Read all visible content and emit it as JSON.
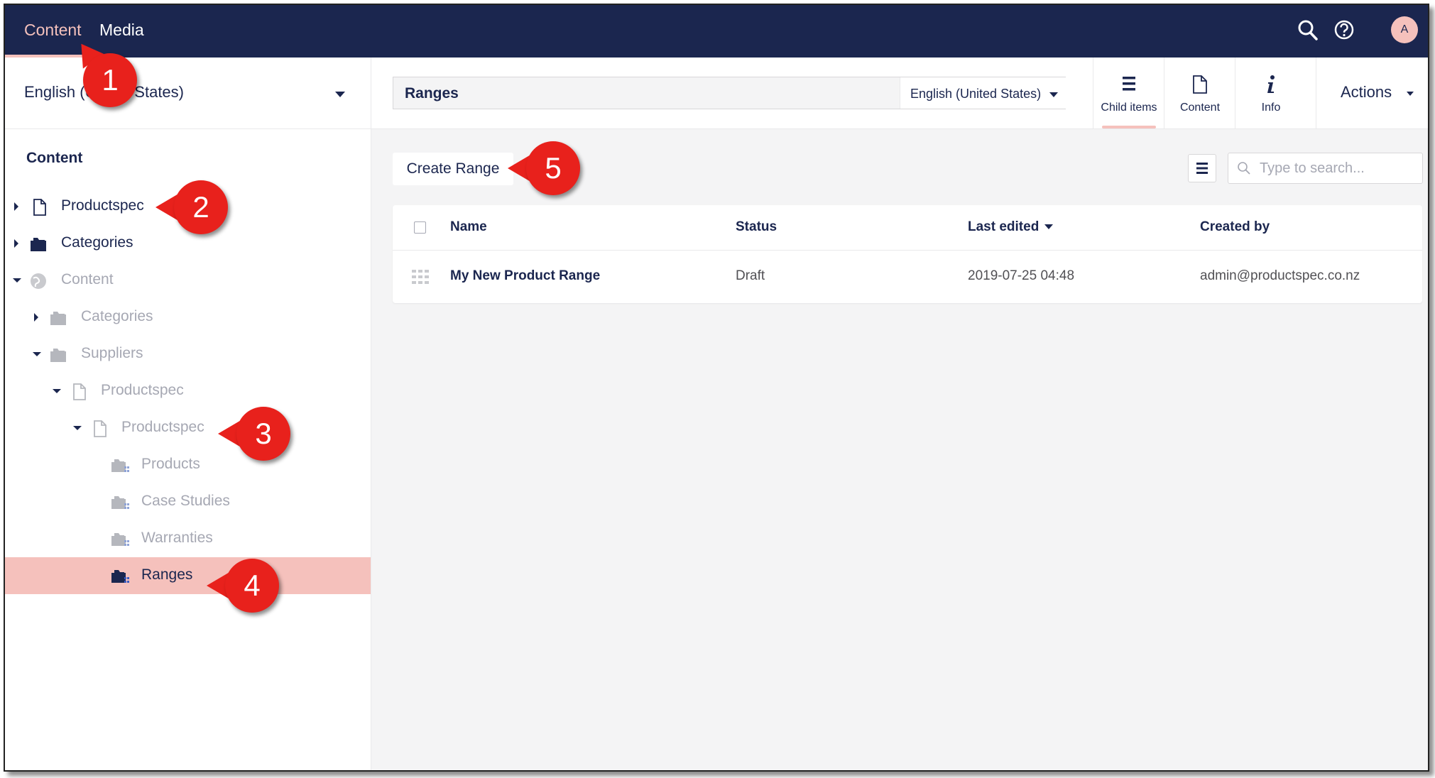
{
  "topbar": {
    "sections": [
      {
        "label": "Content",
        "active": true
      },
      {
        "label": "Media",
        "active": false
      }
    ],
    "avatar_initial": "A"
  },
  "tree": {
    "language": "English (United States)",
    "title": "Content",
    "nodes": [
      {
        "label": "Productspec"
      },
      {
        "label": "Categories"
      },
      {
        "label": "Content"
      },
      {
        "label": "Categories"
      },
      {
        "label": "Suppliers"
      },
      {
        "label": "Productspec"
      },
      {
        "label": "Productspec"
      },
      {
        "label": "Products"
      },
      {
        "label": "Case Studies"
      },
      {
        "label": "Warranties"
      },
      {
        "label": "Ranges"
      }
    ]
  },
  "editor": {
    "name": "Ranges",
    "language": "English (United States)",
    "apps": [
      {
        "label": "Child items",
        "icon": "list-icon",
        "active": true
      },
      {
        "label": "Content",
        "icon": "document-icon",
        "active": false
      },
      {
        "label": "Info",
        "icon": "info-icon",
        "active": false
      }
    ],
    "actions_label": "Actions",
    "create_button": "Create Range",
    "search_placeholder": "Type to search...",
    "table": {
      "columns": [
        "Name",
        "Status",
        "Last edited",
        "Created by"
      ],
      "rows": [
        {
          "name": "My New Product Range",
          "status": "Draft",
          "last_edited": "2019-07-25 04:48",
          "created_by": "admin@productspec.co.nz"
        }
      ]
    }
  },
  "annotations": [
    "1",
    "2",
    "3",
    "4",
    "5"
  ],
  "colors": {
    "topbar": "#1b264f",
    "accent": "#f5c1bc",
    "callout": "#e8211c",
    "background": "#f4f4f5"
  }
}
